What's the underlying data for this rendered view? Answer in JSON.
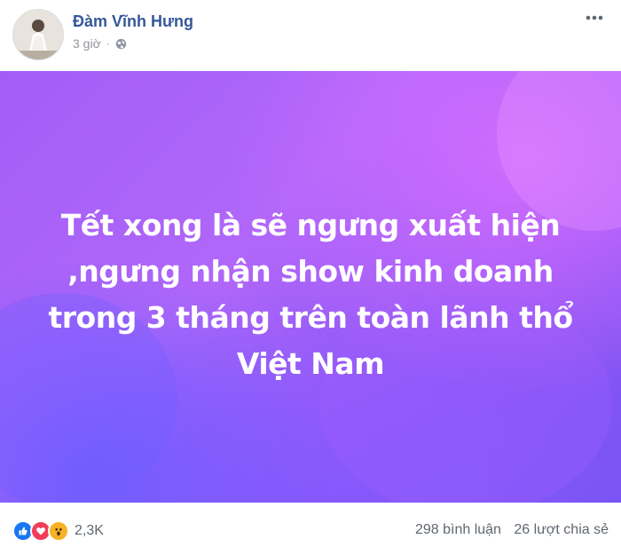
{
  "post": {
    "author": "Đàm Vĩnh Hưng",
    "time": "3 giờ",
    "privacy_icon": "globe-icon",
    "menu_icon": "more-options-icon",
    "status_lines": [
      "Tết xong là sẽ ngưng xuất hiện",
      ",ngưng nhận show kinh doanh",
      "trong 3 tháng trên toàn lãnh thổ",
      "Việt Nam"
    ],
    "background_colors": [
      "#a35df7",
      "#d66eff",
      "#6c5cff"
    ]
  },
  "footer": {
    "reaction_icons": [
      "like-icon",
      "love-icon",
      "wow-icon"
    ],
    "reaction_count": "2,3K",
    "comments": "298 bình luận",
    "shares": "26 lượt chia sẻ"
  },
  "colors": {
    "author_link": "#365899",
    "meta_text": "#90949c",
    "like": "#1877f2",
    "love": "#f33e58",
    "wow": "#f7b125"
  }
}
